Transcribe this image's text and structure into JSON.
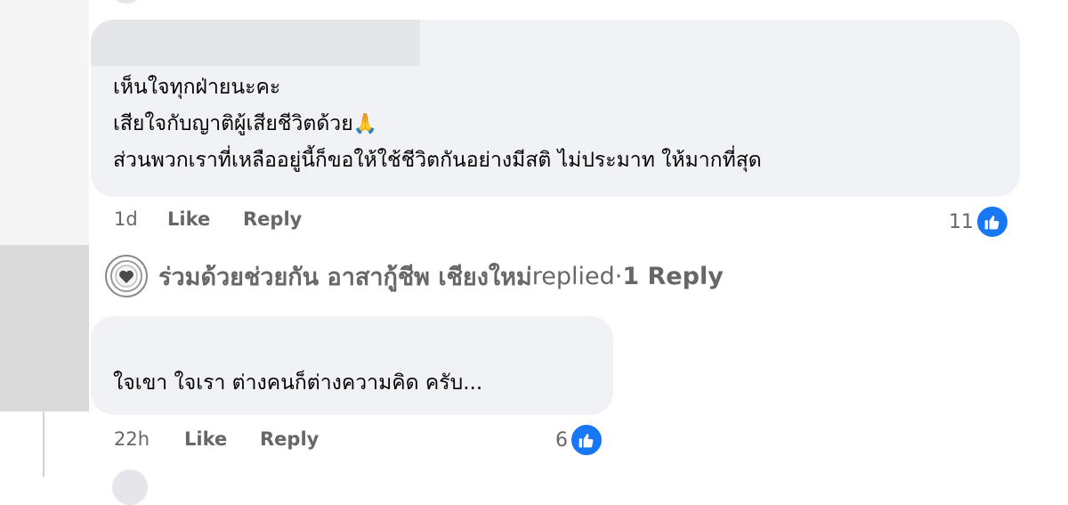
{
  "comments": [
    {
      "lines": [
        "เห็นใจทุกฝ่ายนะคะ",
        "เสียใจกับญาติผู้เสียชีวิตด้วย",
        "ส่วนพวกเราที่เหลืออยู่นี้ก็ขอให้ใช้ชีวิตกันอย่างมีสติ ไม่ประมาท ให้มากที่สุด"
      ],
      "emoji": "🙏",
      "time": "1d",
      "like_label": "Like",
      "reply_label": "Reply",
      "reaction_count": "11",
      "reaction_icon": "like-thumb-icon"
    },
    {
      "lines": [
        "ใจเขา ใจเรา ต่างคนก็ต่างความคิด ครับ..."
      ],
      "time": "22h",
      "like_label": "Like",
      "reply_label": "Reply",
      "reaction_count": "6",
      "reaction_icon": "like-thumb-icon"
    }
  ],
  "replies_summary": {
    "name": "ร่วมด้วยช่วยกัน อาสากู้ชีพ เชียงใหม่",
    "action": " replied",
    "separator": " · ",
    "count": "1 Reply"
  },
  "colors": {
    "bubble": "#f0f2f5",
    "secondary_text": "#65676b",
    "like_blue": "#1877f2"
  }
}
